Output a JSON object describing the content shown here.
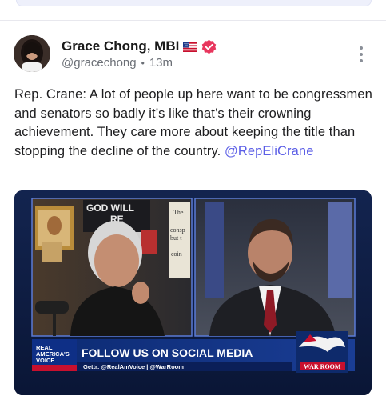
{
  "post": {
    "author_name": "Grace Chong, MBI",
    "handle": "@gracechong",
    "time_ago": "13m",
    "text_main": "Rep. Crane: A lot of people up here want to be congressmen and senators so badly it’s like that’s their crowning achievement. They care more about keeping the title than stopping the decline of the country.",
    "mention": "@RepEliCrane",
    "icons": {
      "flag": "us-flag-icon",
      "verified": "verified-badge-icon",
      "more": "more-vertical-icon"
    }
  },
  "media": {
    "banner": {
      "logo_line1": "REAL",
      "logo_line2": "AMERICA'S",
      "logo_line3": "VOICE",
      "headline": "FOLLOW US ON SOCIAL MEDIA",
      "subline": "Gettr: @RealAmVoice | @WarRoom",
      "badge": "WAR ROOM"
    },
    "left_panel": {
      "sign_text_1": "GOD WILL",
      "sign_text_2": "RE",
      "book_text_1": "The",
      "book_text_2": "consp",
      "book_text_3": "but t",
      "book_text_4": "coin"
    }
  },
  "colors": {
    "accent": "#5b5ee6",
    "verified": "#e8365d",
    "text": "#1d1d1f",
    "muted": "#6b6f76",
    "broadcast_blue": "#0e2a6b",
    "banner_red": "#c8102e"
  }
}
